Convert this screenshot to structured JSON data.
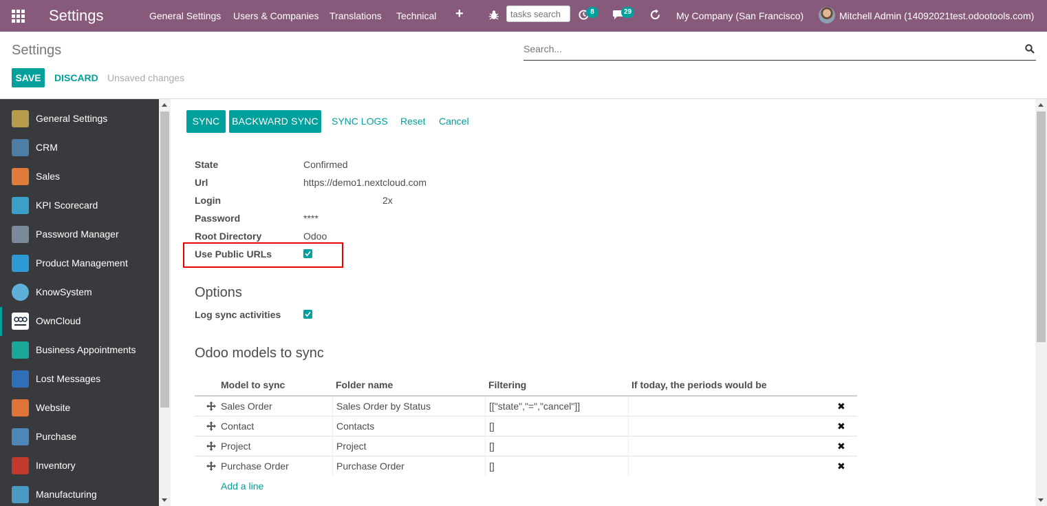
{
  "navbar": {
    "brand": "Settings",
    "menu": [
      "General Settings",
      "Users & Companies",
      "Translations",
      "Technical"
    ],
    "tasks_search_placeholder": "tasks search",
    "activity_count": "8",
    "messages_count": "29",
    "company": "My Company (San Francisco)",
    "user": "Mitchell Admin (14092021test.odootools.com)",
    "icons": [
      "apps-grid-icon",
      "plus-icon",
      "bug-icon",
      "clock-icon",
      "chat-icon",
      "refresh-icon"
    ]
  },
  "control_panel": {
    "title": "Settings",
    "search_placeholder": "Search...",
    "save_label": "SAVE",
    "discard_label": "DISCARD",
    "unsaved_label": "Unsaved changes"
  },
  "sidebar": {
    "items": [
      {
        "label": "General Settings",
        "color": "#b59b4a"
      },
      {
        "label": "CRM",
        "color": "#4d7ea8"
      },
      {
        "label": "Sales",
        "color": "#e07b39"
      },
      {
        "label": "KPI Scorecard",
        "color": "#3aa0c8"
      },
      {
        "label": "Password Manager",
        "color": "#7a8a9a"
      },
      {
        "label": "Product Management",
        "color": "#2e9bd6"
      },
      {
        "label": "KnowSystem",
        "color": "#5fb0d8"
      },
      {
        "label": "OwnCloud",
        "color": "#ffffff"
      },
      {
        "label": "Business Appointments",
        "color": "#1aa89a"
      },
      {
        "label": "Lost Messages",
        "color": "#2f6fb5"
      },
      {
        "label": "Website",
        "color": "#e0733a"
      },
      {
        "label": "Purchase",
        "color": "#4d87b8"
      },
      {
        "label": "Inventory",
        "color": "#c0392b"
      },
      {
        "label": "Manufacturing",
        "color": "#4a9ac4"
      }
    ],
    "active_index": 7
  },
  "actions": {
    "sync": "SYNC",
    "backward_sync": "BACKWARD SYNC",
    "sync_logs": "SYNC LOGS",
    "reset": "Reset",
    "cancel": "Cancel"
  },
  "fields": [
    {
      "label": "State",
      "value": "Confirmed"
    },
    {
      "label": "Url",
      "value": "https://demo1.nextcloud.com"
    },
    {
      "label": "Login",
      "value": "2x"
    },
    {
      "label": "Password",
      "value": "****"
    },
    {
      "label": "Root Directory",
      "value": "Odoo"
    },
    {
      "label": "Use Public URLs",
      "value": ""
    }
  ],
  "use_public_urls_checked": true,
  "options": {
    "title": "Options",
    "log_sync_label": "Log sync activities",
    "log_sync_checked": true
  },
  "models": {
    "title": "Odoo models to sync",
    "columns": [
      "Model to sync",
      "Folder name",
      "Filtering",
      "If today, the periods would be"
    ],
    "rows": [
      {
        "model": "Sales Order",
        "folder": "Sales Order by Status",
        "filter": "[[\"state\",\"=\",\"cancel\"]]",
        "periods": ""
      },
      {
        "model": "Contact",
        "folder": "Contacts",
        "filter": "[]",
        "periods": ""
      },
      {
        "model": "Project",
        "folder": "Project",
        "filter": "[]",
        "periods": ""
      },
      {
        "model": "Purchase Order",
        "folder": "Purchase Order",
        "filter": "[]",
        "periods": ""
      }
    ],
    "add_line": "Add a line"
  },
  "colors": {
    "navbar": "#875a7b",
    "primary": "#00a09d",
    "sidebar": "#393a3d",
    "highlight": "#e60000"
  }
}
